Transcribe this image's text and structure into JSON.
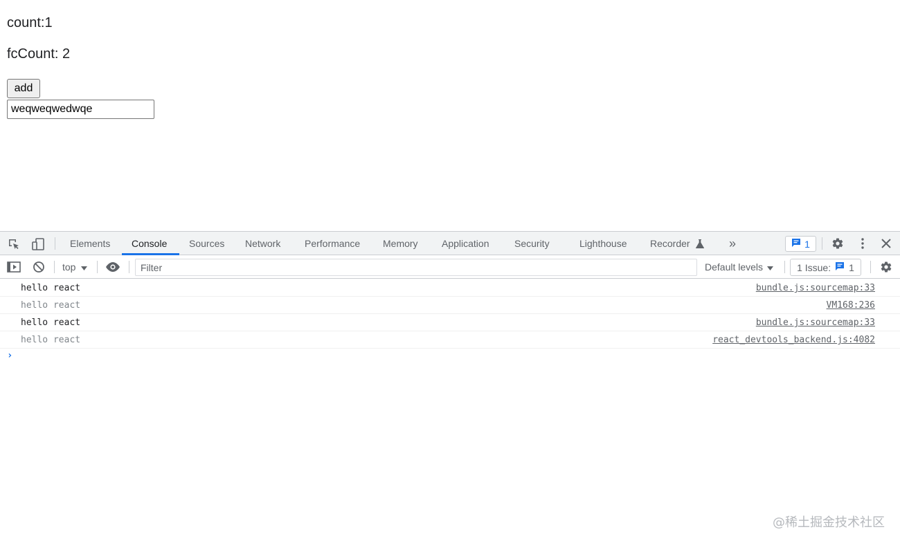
{
  "page": {
    "count_text": "count:1",
    "fccount_text": "fcCount: 2",
    "add_button_label": "add",
    "input_value": "weqweqwedwqe"
  },
  "devtools": {
    "tabs": [
      {
        "label": "Elements"
      },
      {
        "label": "Console",
        "active": true
      },
      {
        "label": "Sources"
      },
      {
        "label": "Network"
      },
      {
        "label": "Performance"
      },
      {
        "label": "Memory"
      },
      {
        "label": "Application"
      },
      {
        "label": "Security"
      },
      {
        "label": "Lighthouse"
      },
      {
        "label": "Recorder"
      }
    ],
    "more_tabs_glyph": "»",
    "issues_count": "1",
    "toolbar": {
      "context": "top",
      "filter_placeholder": "Filter",
      "levels": "Default levels",
      "issue_label": "1 Issue:",
      "issue_count": "1"
    },
    "messages": [
      {
        "text": "hello react",
        "source": "bundle.js:sourcemap:33",
        "dim": false
      },
      {
        "text": "hello react",
        "source": "VM168:236",
        "dim": true
      },
      {
        "text": "hello react",
        "source": "bundle.js:sourcemap:33",
        "dim": false
      },
      {
        "text": "hello react",
        "source": "react_devtools_backend.js:4082",
        "dim": true
      }
    ],
    "prompt_glyph": "›"
  },
  "watermark": "@稀土掘金技术社区",
  "colors": {
    "accent": "#1a73e8",
    "tabbar_bg": "#f1f3f4",
    "border": "#cacdd1"
  },
  "icons": {
    "inspect": "inspect-element-icon",
    "device": "device-toolbar-icon",
    "recorder": "flask-icon",
    "issues": "message-icon",
    "settings": "gear-icon",
    "menu": "kebab-menu-icon",
    "close": "close-icon",
    "sidebar": "sidebar-toggle-icon",
    "clear": "clear-console-icon",
    "eye": "live-expression-icon"
  }
}
